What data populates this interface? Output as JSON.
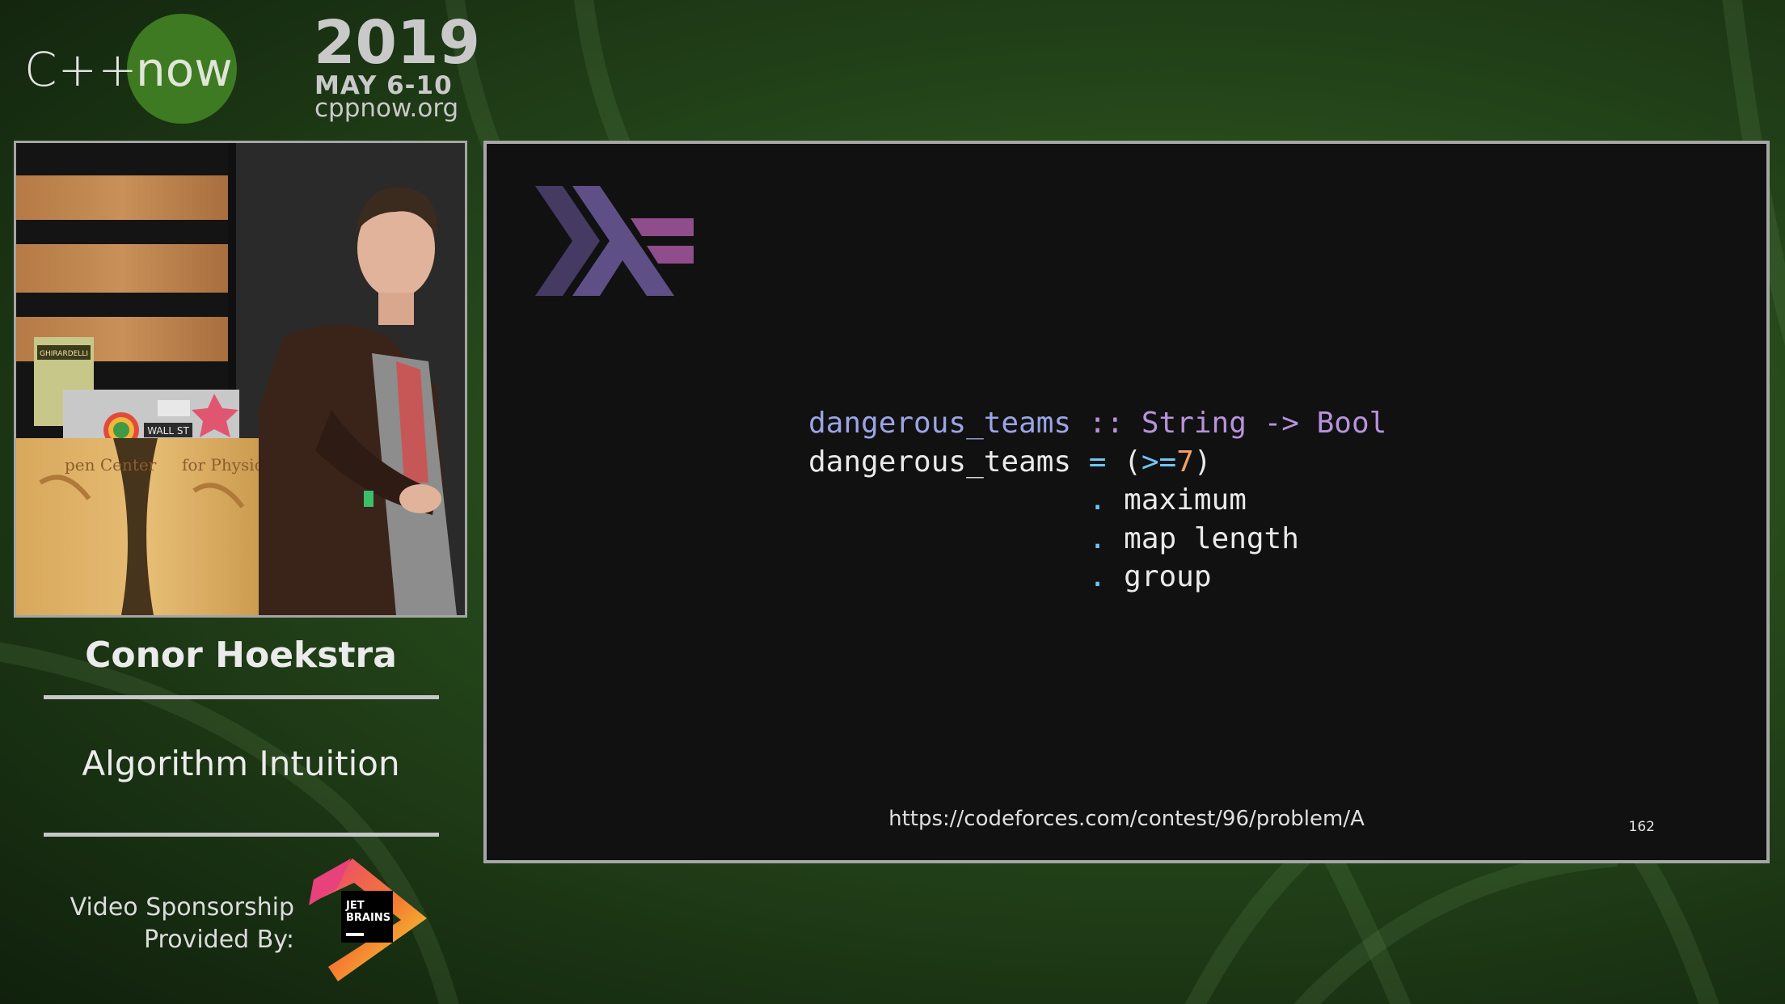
{
  "header": {
    "logo_cpp": "C++",
    "logo_now": "now",
    "year": "2019",
    "dates": "MAY 6-10",
    "site": "cppnow.org"
  },
  "speaker": {
    "name": "Conor Hoekstra",
    "talk_title": "Algorithm Intuition",
    "video_scene": {
      "box_label": "GHIRARDELLI",
      "podium_text_left": "pen Center",
      "podium_text_right": "for Physics",
      "sticker_text": "WALL ST"
    }
  },
  "sponsor": {
    "line1": "Video Sponsorship",
    "line2": "Provided By:",
    "brand_line1": "JET",
    "brand_line2": "BRAINS"
  },
  "slide": {
    "code": {
      "line1": {
        "name": "dangerous_teams",
        "op": "::",
        "t1": "String",
        "arrow": "->",
        "t2": "Bool"
      },
      "line2": {
        "name": "dangerous_teams",
        "eq": "=",
        "paren_open": "(",
        "op": ">=",
        "num": "7",
        "paren_close": ")"
      },
      "line3": {
        "dot": ".",
        "fn": "maximum"
      },
      "line4": {
        "dot": ".",
        "fn": "map length"
      },
      "line5": {
        "dot": ".",
        "fn": "group"
      }
    },
    "url": "https://codeforces.com/contest/96/problem/A",
    "page_number": "162"
  },
  "colors": {
    "function_name": "#9ba4e6",
    "type_keyword": "#b693dc",
    "operator_accent": "#6fc6f6",
    "number": "#f0a066",
    "haskell_logo_dark": "#453a62",
    "haskell_logo_mid": "#5e5086",
    "haskell_logo_light": "#8f4e8b",
    "brand_green": "#3d7a22"
  }
}
